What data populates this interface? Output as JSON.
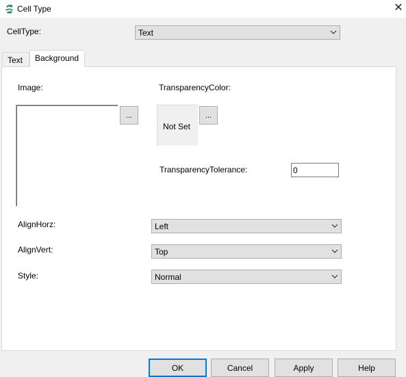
{
  "window": {
    "title": "Cell Type",
    "close_symbol": "✕"
  },
  "celltype": {
    "label": "CellType:",
    "value": "Text"
  },
  "tabs": [
    {
      "label": "Text",
      "active": false
    },
    {
      "label": "Background",
      "active": true
    }
  ],
  "background": {
    "image_label": "Image:",
    "image_browse": "...",
    "transparency_color_label": "TransparencyColor:",
    "transparency_color_value": "Not Set",
    "transparency_color_browse": "...",
    "transparency_tolerance_label": "TransparencyTolerance:",
    "transparency_tolerance_value": "0",
    "align_horz_label": "AlignHorz:",
    "align_horz_value": "Left",
    "align_vert_label": "AlignVert:",
    "align_vert_value": "Top",
    "style_label": "Style:",
    "style_value": "Normal"
  },
  "buttons": {
    "ok": "OK",
    "cancel": "Cancel",
    "apply": "Apply",
    "help": "Help"
  },
  "colors": {
    "accent": "#0078d7",
    "panel": "#ffffff",
    "window": "#f0f0f0",
    "icon_green": "#2e8b57"
  }
}
